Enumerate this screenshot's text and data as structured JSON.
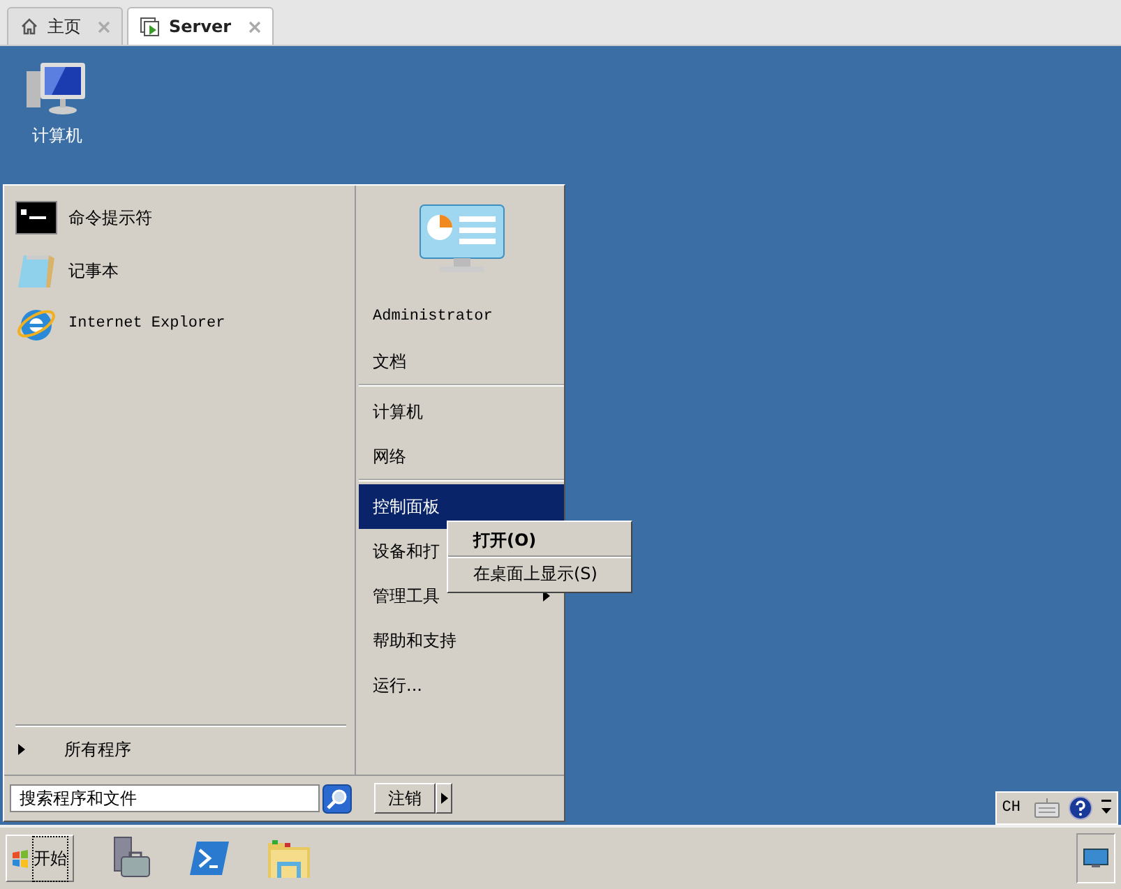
{
  "tabs": [
    {
      "label": "主页",
      "kind": "home",
      "selected": false
    },
    {
      "label": "Server",
      "kind": "vm",
      "selected": true
    }
  ],
  "desktop_icons": [
    {
      "label": "计算机"
    }
  ],
  "start_menu": {
    "pinned": [
      {
        "label": "命令提示符",
        "kind": "cmd"
      },
      {
        "label": "记事本",
        "kind": "notepad"
      },
      {
        "label": "Internet Explorer",
        "kind": "ie"
      }
    ],
    "all_programs": "所有程序",
    "search": {
      "placeholder": "搜索程序和文件"
    },
    "user": "Administrator",
    "right_items": [
      {
        "label": "文档",
        "selected": false,
        "separator_after": true
      },
      {
        "label": "计算机",
        "selected": false,
        "separator_after": false
      },
      {
        "label": "网络",
        "selected": false,
        "separator_after": true
      },
      {
        "label": "控制面板",
        "selected": true,
        "separator_after": false
      },
      {
        "label": "设备和打",
        "selected": false,
        "separator_after": false
      },
      {
        "label": "管理工具",
        "selected": false,
        "submenu": true,
        "separator_after": false
      },
      {
        "label": "帮助和支持",
        "selected": false,
        "separator_after": false
      },
      {
        "label": "运行...",
        "selected": false,
        "separator_after": false
      }
    ],
    "logoff": "注销"
  },
  "context_menu": [
    {
      "label": "打开(O)",
      "default": true
    },
    {
      "label": "在桌面上显示(S)",
      "default": false
    }
  ],
  "taskbar": {
    "start": "开始",
    "apps": [
      {
        "kind": "server-manager"
      },
      {
        "kind": "powershell"
      },
      {
        "kind": "explorer"
      }
    ]
  },
  "language_bar": {
    "language": "CH"
  }
}
